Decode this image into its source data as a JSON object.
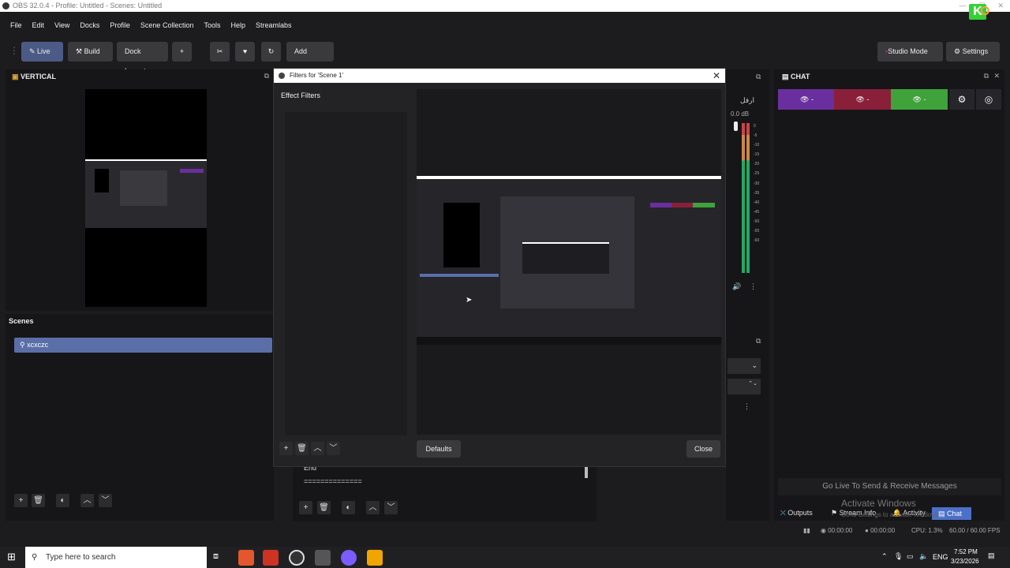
{
  "window": {
    "title": "OBS 32.0.4 - Profile: Untitled - Scenes: Untitled"
  },
  "menu": [
    "File",
    "Edit",
    "View",
    "Docks",
    "Profile",
    "Scene Collection",
    "Tools",
    "Help",
    "Streamlabs"
  ],
  "toolbar": {
    "live": "Live",
    "build": "Build",
    "dock_layout": "Dock Layout",
    "plus": "+",
    "add_canvas": "Add Canvas",
    "studio_mode": "Studio Mode",
    "settings": "Settings"
  },
  "vertical_panel": {
    "title": "VERTICAL"
  },
  "scenes_panel": {
    "title": "Scenes",
    "items": [
      "xcxczc"
    ]
  },
  "dialog": {
    "title": "Filters for 'Scene 1'",
    "effect_filters": "Effect Filters",
    "defaults": "Defaults",
    "close": "Close"
  },
  "audio": {
    "label": "ارفل",
    "db": "0.0 dB",
    "ticks": [
      "0",
      "-5",
      "-10",
      "-15",
      "-20",
      "-25",
      "-30",
      "-35",
      "-40",
      "-45",
      "-50",
      "-55",
      "-60"
    ]
  },
  "chat_panel": {
    "title": "CHAT",
    "placeholder": "Go Live To Send & Receive Messages",
    "tabs": [
      "Outputs",
      "Stream Info",
      "Activity",
      "Chat"
    ]
  },
  "bottom_text": {
    "end": "End",
    "separator": "=============="
  },
  "watermark": {
    "line1": "Activate Windows",
    "line2": "Go to Settings to activate Windows."
  },
  "status": {
    "time1": "00:00:00",
    "time2": "00:00:00",
    "cpu": "CPU: 1.3%",
    "fps": "60.00 / 60.00 FPS"
  },
  "taskbar": {
    "search_placeholder": "Type here to search",
    "lang": "ENG",
    "clock_time": "7:52 PM",
    "clock_date": "3/23/2026"
  },
  "colors": {
    "live": "#4c5a86",
    "scene_selected": "#5a6ea8",
    "chat_purple": "#6a2f9e",
    "chat_red": "#8a1f3a",
    "chat_green": "#3fa23a",
    "chat_tab_active": "#4c70c8"
  }
}
